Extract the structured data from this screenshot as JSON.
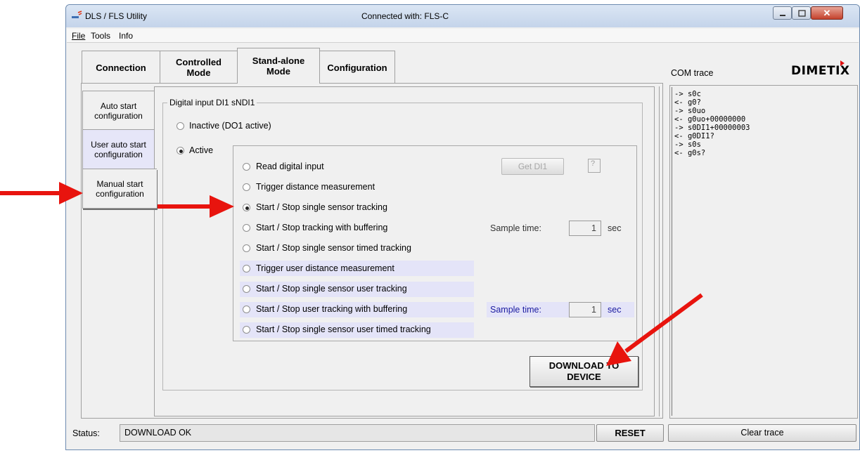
{
  "window": {
    "title": "DLS / FLS Utility",
    "connection_text": "Connected with: FLS-C"
  },
  "menu": [
    "File",
    "Tools",
    "Info"
  ],
  "tabs": [
    {
      "label": "Connection"
    },
    {
      "label": "Controlled\nMode"
    },
    {
      "label": "Stand-alone\nMode",
      "active": true
    },
    {
      "label": "Configuration"
    }
  ],
  "side_tabs": [
    {
      "label": "Auto start\nconfiguration"
    },
    {
      "label": "User auto start\nconfiguration"
    },
    {
      "label": "Manual start\nconfiguration",
      "active": true
    }
  ],
  "group": {
    "title": "Digital input DI1 sNDI1",
    "inactive_label": "Inactive (DO1 active)",
    "active_label": "Active",
    "active_selected": true
  },
  "options": [
    {
      "label": "Read digital input",
      "selected": false
    },
    {
      "label": "Trigger distance measurement",
      "selected": false
    },
    {
      "label": "Start / Stop single sensor tracking",
      "selected": true
    },
    {
      "label": "Start / Stop tracking with buffering",
      "selected": false
    },
    {
      "label": "Start / Stop single sensor timed tracking",
      "selected": false
    },
    {
      "label": "Trigger user distance measurement",
      "selected": false
    },
    {
      "label": "Start / Stop single sensor user tracking",
      "selected": false
    },
    {
      "label": "Start / Stop user tracking with buffering",
      "selected": false
    },
    {
      "label": "Start / Stop single sensor user timed tracking",
      "selected": false
    }
  ],
  "get_di1": {
    "label": "Get DI1",
    "value": "?"
  },
  "sample1": {
    "label": "Sample time:",
    "value": "1",
    "unit": "sec"
  },
  "sample2": {
    "label": "Sample time:",
    "value": "1",
    "unit": "sec"
  },
  "download": {
    "line1": "DOWNLOAD TO",
    "line2": "DEVICE"
  },
  "com_trace": {
    "label": "COM trace",
    "logo": "DIMETIX",
    "lines": [
      "-> s0c",
      "<- g0?",
      "-> s0uo",
      "<- g0uo+00000000",
      "-> s0DI1+00000003",
      "<- g0DI1?",
      "-> s0s",
      "<- g0s?"
    ]
  },
  "status": {
    "label": "Status:",
    "value": "DOWNLOAD OK"
  },
  "reset_label": "RESET",
  "clear_label": "Clear trace",
  "colors": {
    "arrow": "#e8140e",
    "highlight": "#e4e4f8"
  }
}
